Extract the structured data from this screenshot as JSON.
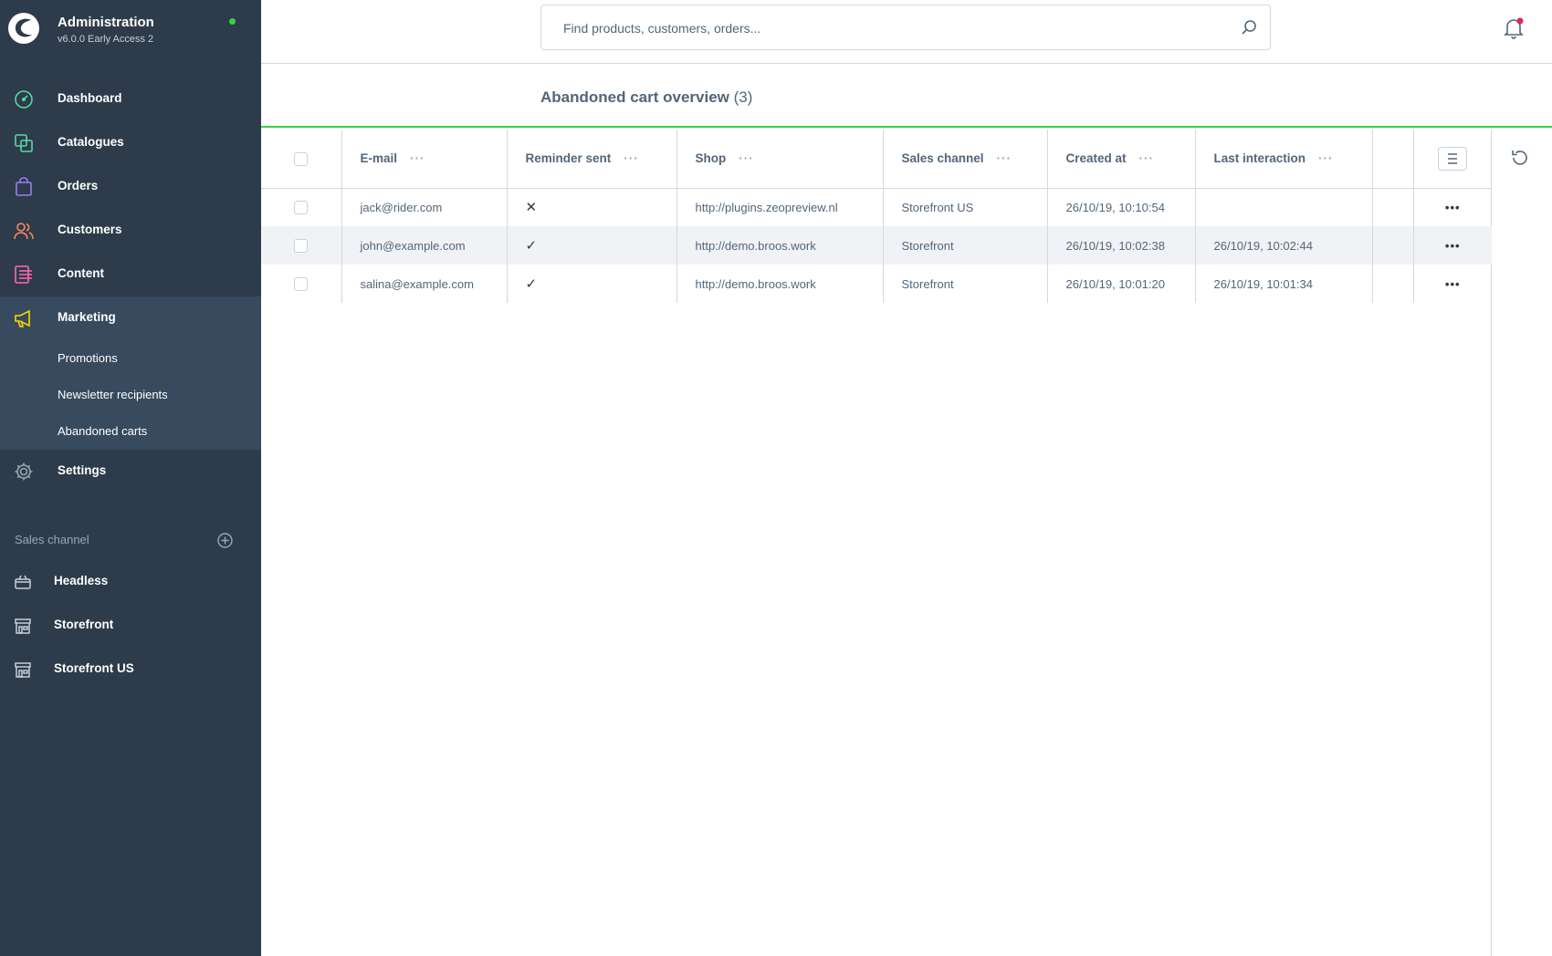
{
  "app": {
    "title": "Administration",
    "version": "v6.0.0 Early Access 2",
    "status_color": "#37d046"
  },
  "nav": {
    "items": [
      {
        "label": "Dashboard",
        "icon": "dashboard-icon",
        "color": "#57d9a3"
      },
      {
        "label": "Catalogues",
        "icon": "catalogue-icon",
        "color": "#57d9a3"
      },
      {
        "label": "Orders",
        "icon": "bag-icon",
        "color": "#9a7ff5"
      },
      {
        "label": "Customers",
        "icon": "users-icon",
        "color": "#f88962"
      },
      {
        "label": "Content",
        "icon": "content-icon",
        "color": "#ff68b4"
      },
      {
        "label": "Marketing",
        "icon": "megaphone-icon",
        "color": "#ffd700"
      },
      {
        "label": "Settings",
        "icon": "gear-icon",
        "color": "#9aa8b5"
      }
    ],
    "marketing_sub": [
      "Promotions",
      "Newsletter recipients",
      "Abandoned carts"
    ]
  },
  "sales_channel": {
    "heading": "Sales channel",
    "items": [
      {
        "label": "Headless",
        "icon": "basket-icon"
      },
      {
        "label": "Storefront",
        "icon": "storefront-icon"
      },
      {
        "label": "Storefront US",
        "icon": "storefront-icon"
      }
    ]
  },
  "search": {
    "placeholder": "Find products, customers, orders..."
  },
  "page": {
    "title": "Abandoned cart overview",
    "count": "(3)"
  },
  "table": {
    "columns": [
      "E-mail",
      "Reminder sent",
      "Shop",
      "Sales channel",
      "Created at",
      "Last interaction"
    ],
    "rows": [
      {
        "email": "jack@rider.com",
        "reminder": "✕",
        "shop": "http://plugins.zeopreview.nl",
        "channel": "Storefront US",
        "created": "26/10/19, 10:10:54",
        "last": ""
      },
      {
        "email": "john@example.com",
        "reminder": "✓",
        "shop": "http://demo.broos.work",
        "channel": "Storefront",
        "created": "26/10/19, 10:02:38",
        "last": "26/10/19, 10:02:44"
      },
      {
        "email": "salina@example.com",
        "reminder": "✓",
        "shop": "http://demo.broos.work",
        "channel": "Storefront",
        "created": "26/10/19, 10:01:20",
        "last": "26/10/19, 10:01:34"
      }
    ],
    "header_dots": "···",
    "row_dots": "•••"
  },
  "colors": {
    "sidebar_bg": "#2d3b4a",
    "sidebar_active_bg": "#374a5e",
    "accent_green": "#37d046",
    "notification_dot": "#de294c"
  }
}
